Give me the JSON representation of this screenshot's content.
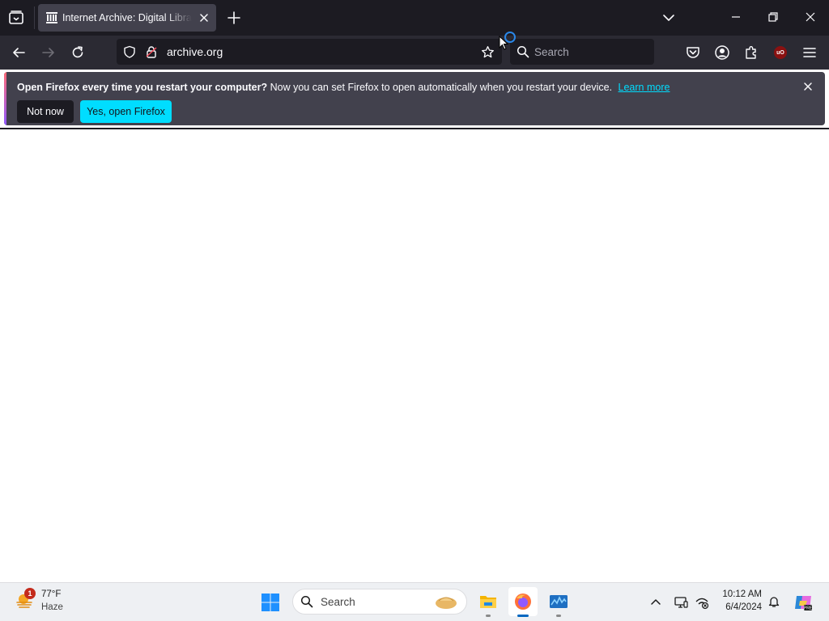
{
  "browser": {
    "tab": {
      "title": "Internet Archive: Digital Library of Free & Borrowable Books, Movies, Music & Wayback Machine"
    },
    "address": {
      "url": "archive.org"
    },
    "search": {
      "placeholder": "Search"
    },
    "extensions": {
      "ublock_label": "uO"
    }
  },
  "notification": {
    "bold_text": "Open Firefox every time you restart your computer?",
    "text": "Now you can set Firefox to open automatically when you restart your device.",
    "link_label": "Learn more",
    "not_now_label": "Not now",
    "yes_label": "Yes, open Firefox"
  },
  "taskbar": {
    "weather": {
      "temperature": "77°F",
      "condition": "Haze",
      "badge_count": "1"
    },
    "search": {
      "label": "Search"
    },
    "clock": {
      "time": "10:12 AM",
      "date": "6/4/2024"
    }
  },
  "colors": {
    "tab_strip": "#1c1b22",
    "toolbar": "#2b2a33",
    "notification_bg": "#42414d",
    "primary_button": "#00ddff",
    "link": "#00ddff",
    "taskbar": "#eef0f3",
    "active_indicator": "#0067c0"
  },
  "icons": {
    "tabstrip": [
      "tab-manager-icon",
      "archive-favicon-icon",
      "close-icon",
      "plus-icon",
      "chevron-down-icon",
      "minimize-icon",
      "restore-icon",
      "window-close-icon"
    ],
    "navbar": [
      "back-arrow-icon",
      "forward-arrow-icon",
      "reload-icon",
      "shield-icon",
      "lock-icon",
      "star-icon",
      "search-icon",
      "pocket-icon",
      "account-icon",
      "extensions-icon",
      "ublock-icon",
      "menu-icon"
    ],
    "taskbar": [
      "weather-icon",
      "windows-start-icon",
      "search-icon",
      "file-explorer-icon",
      "firefox-icon",
      "performance-monitor-icon",
      "chevron-up-icon",
      "display-icon",
      "network-off-icon",
      "bell-icon",
      "copilot-icon"
    ]
  }
}
